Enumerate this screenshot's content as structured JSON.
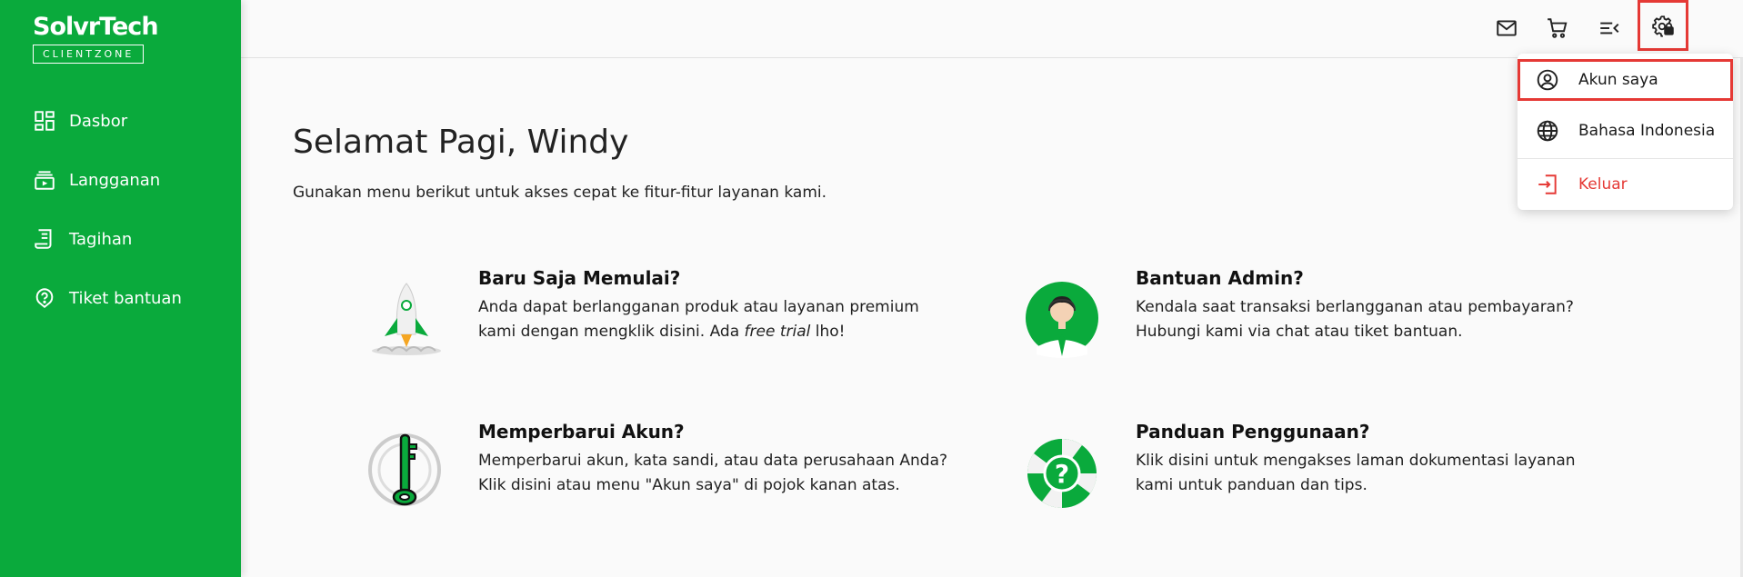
{
  "brand": {
    "name": "SolvrTech",
    "sub": "CLIENTZONE"
  },
  "sidebar": {
    "items": [
      {
        "label": "Dasbor",
        "icon": "dashboard-icon"
      },
      {
        "label": "Langganan",
        "icon": "subscription-icon"
      },
      {
        "label": "Tagihan",
        "icon": "invoice-icon"
      },
      {
        "label": "Tiket bantuan",
        "icon": "help-ticket-icon"
      }
    ]
  },
  "topbar": {
    "icons": [
      "mail-icon",
      "cart-icon",
      "menu-collapse-icon",
      "settings-icon"
    ]
  },
  "dropdown": {
    "items": [
      {
        "label": "Akun saya",
        "icon": "account-circle-icon"
      },
      {
        "label": "Bahasa Indonesia",
        "icon": "globe-icon"
      },
      {
        "label": "Keluar",
        "icon": "logout-icon"
      }
    ]
  },
  "main": {
    "greeting": "Selamat Pagi, Windy",
    "subtitle": "Gunakan menu berikut untuk akses cepat ke fitur-fitur layanan kami.",
    "cards": [
      {
        "title": "Baru Saja Memulai?",
        "line1": "Anda dapat berlangganan produk atau layanan premium",
        "line2_pre": "kami dengan mengklik disini. Ada ",
        "line2_em": "free trial",
        "line2_post": " lho!"
      },
      {
        "title": "Bantuan Admin?",
        "line1": "Kendala saat transaksi berlangganan atau pembayaran?",
        "line2": "Hubungi kami via chat atau tiket bantuan."
      },
      {
        "title": "Memperbarui Akun?",
        "line1": "Memperbarui akun, kata sandi, atau data perusahaan Anda?",
        "line2": "Klik disini atau menu \"Akun saya\" di pojok kanan atas."
      },
      {
        "title": "Panduan Penggunaan?",
        "line1": "Klik disini untuk mengakses laman dokumentasi layanan",
        "line2": "kami untuk panduan dan tips."
      }
    ]
  },
  "colors": {
    "brand_green": "#0aaa3c",
    "highlight_red": "#e53935",
    "logout_red": "#e53935"
  }
}
